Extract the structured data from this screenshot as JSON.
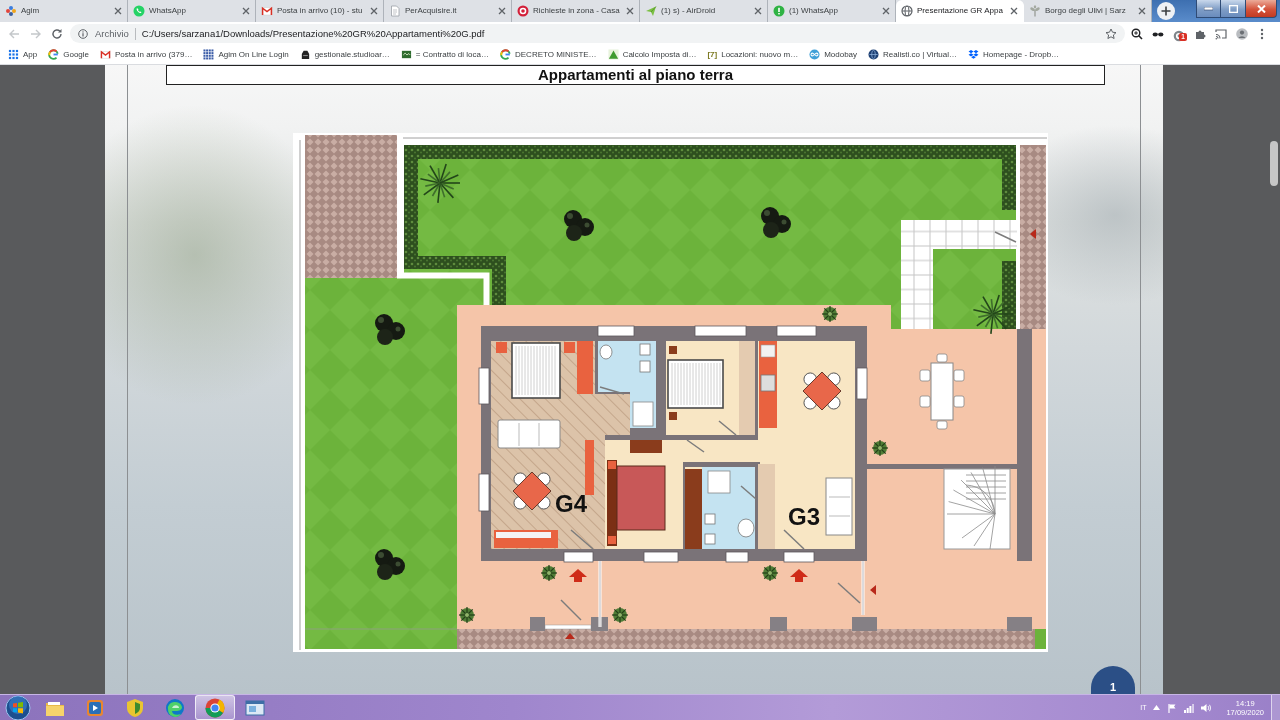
{
  "tabs": [
    {
      "title": "Agim",
      "selected": false
    },
    {
      "title": "WhatsApp",
      "selected": false
    },
    {
      "title": "Posta in arrivo (10) - stu",
      "selected": false
    },
    {
      "title": "PerAcquisire.it",
      "selected": false
    },
    {
      "title": "Richieste in zona - Casa",
      "selected": false
    },
    {
      "title": "(1) s) - AirDroid",
      "selected": false
    },
    {
      "title": "(1) WhatsApp",
      "selected": false
    },
    {
      "title": "Presentazione GR Appa",
      "selected": true
    },
    {
      "title": "Borgo degli Ulivi | Sarz",
      "selected": false
    }
  ],
  "toolbar": {
    "back": {
      "disabled": true
    },
    "forward": {
      "disabled": true
    },
    "site_label": "Archivio",
    "url": "C:/Users/sarzana1/Downloads/Presentazione%20GR%20Appartamenti%20G.pdf",
    "extension_badge": "1"
  },
  "bookmarks": [
    {
      "label": "App"
    },
    {
      "label": "Google"
    },
    {
      "label": "Posta in arrivo (379…"
    },
    {
      "label": "Agim On Line Login"
    },
    {
      "label": "gestionale.studioar…"
    },
    {
      "label": "= Contratto di loca…"
    },
    {
      "label": "DECRETO MINISTE…"
    },
    {
      "label": "Calcolo Imposta di…"
    },
    {
      "label": "Locazioni: nuovo m…",
      "favicon_text": "[7]"
    },
    {
      "label": "Modobay"
    },
    {
      "label": "Realisti.co | Virtual…"
    },
    {
      "label": "Homepage - Dropb…"
    }
  ],
  "pdf": {
    "title": "Appartamenti al piano terra",
    "plan_labels": [
      "G4",
      "G3"
    ],
    "page_number": "1"
  },
  "taskbar": {
    "apps": [
      {
        "selected": false
      },
      {
        "selected": false
      },
      {
        "selected": false
      },
      {
        "selected": false
      },
      {
        "selected": true
      },
      {
        "selected": false
      }
    ],
    "language": "IT",
    "time": "14:19",
    "date": "17/09/2020"
  }
}
